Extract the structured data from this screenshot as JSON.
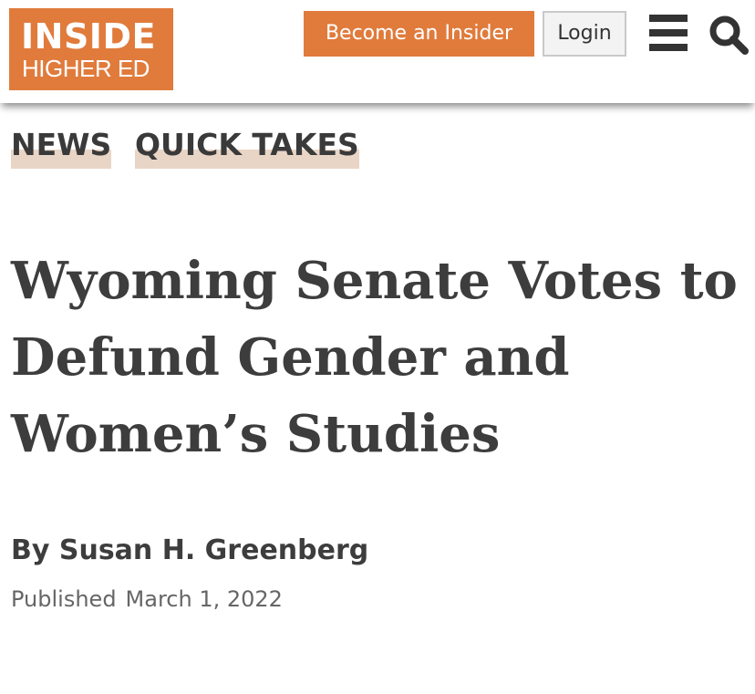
{
  "header": {
    "logo": {
      "line1": "INSIDE",
      "line2": "HIGHER ED"
    },
    "become_insider_label": "Become an Insider",
    "login_label": "Login",
    "menu_icon": "hamburger-menu-icon",
    "search_icon": "search-icon",
    "brand_color": "#e07b3c"
  },
  "tags": [
    {
      "label": "NEWS"
    },
    {
      "label": "QUICK TAKES"
    }
  ],
  "article": {
    "headline": "Wyoming Senate Votes to Defund Gender and Women’s Studies",
    "byline": "By Susan H. Greenberg",
    "published_label": "Published",
    "published_date": "March 1, 2022"
  },
  "colors": {
    "text": "#3d3d3d",
    "tag_highlight": "#e9d5c6",
    "meta_text": "#666666"
  }
}
